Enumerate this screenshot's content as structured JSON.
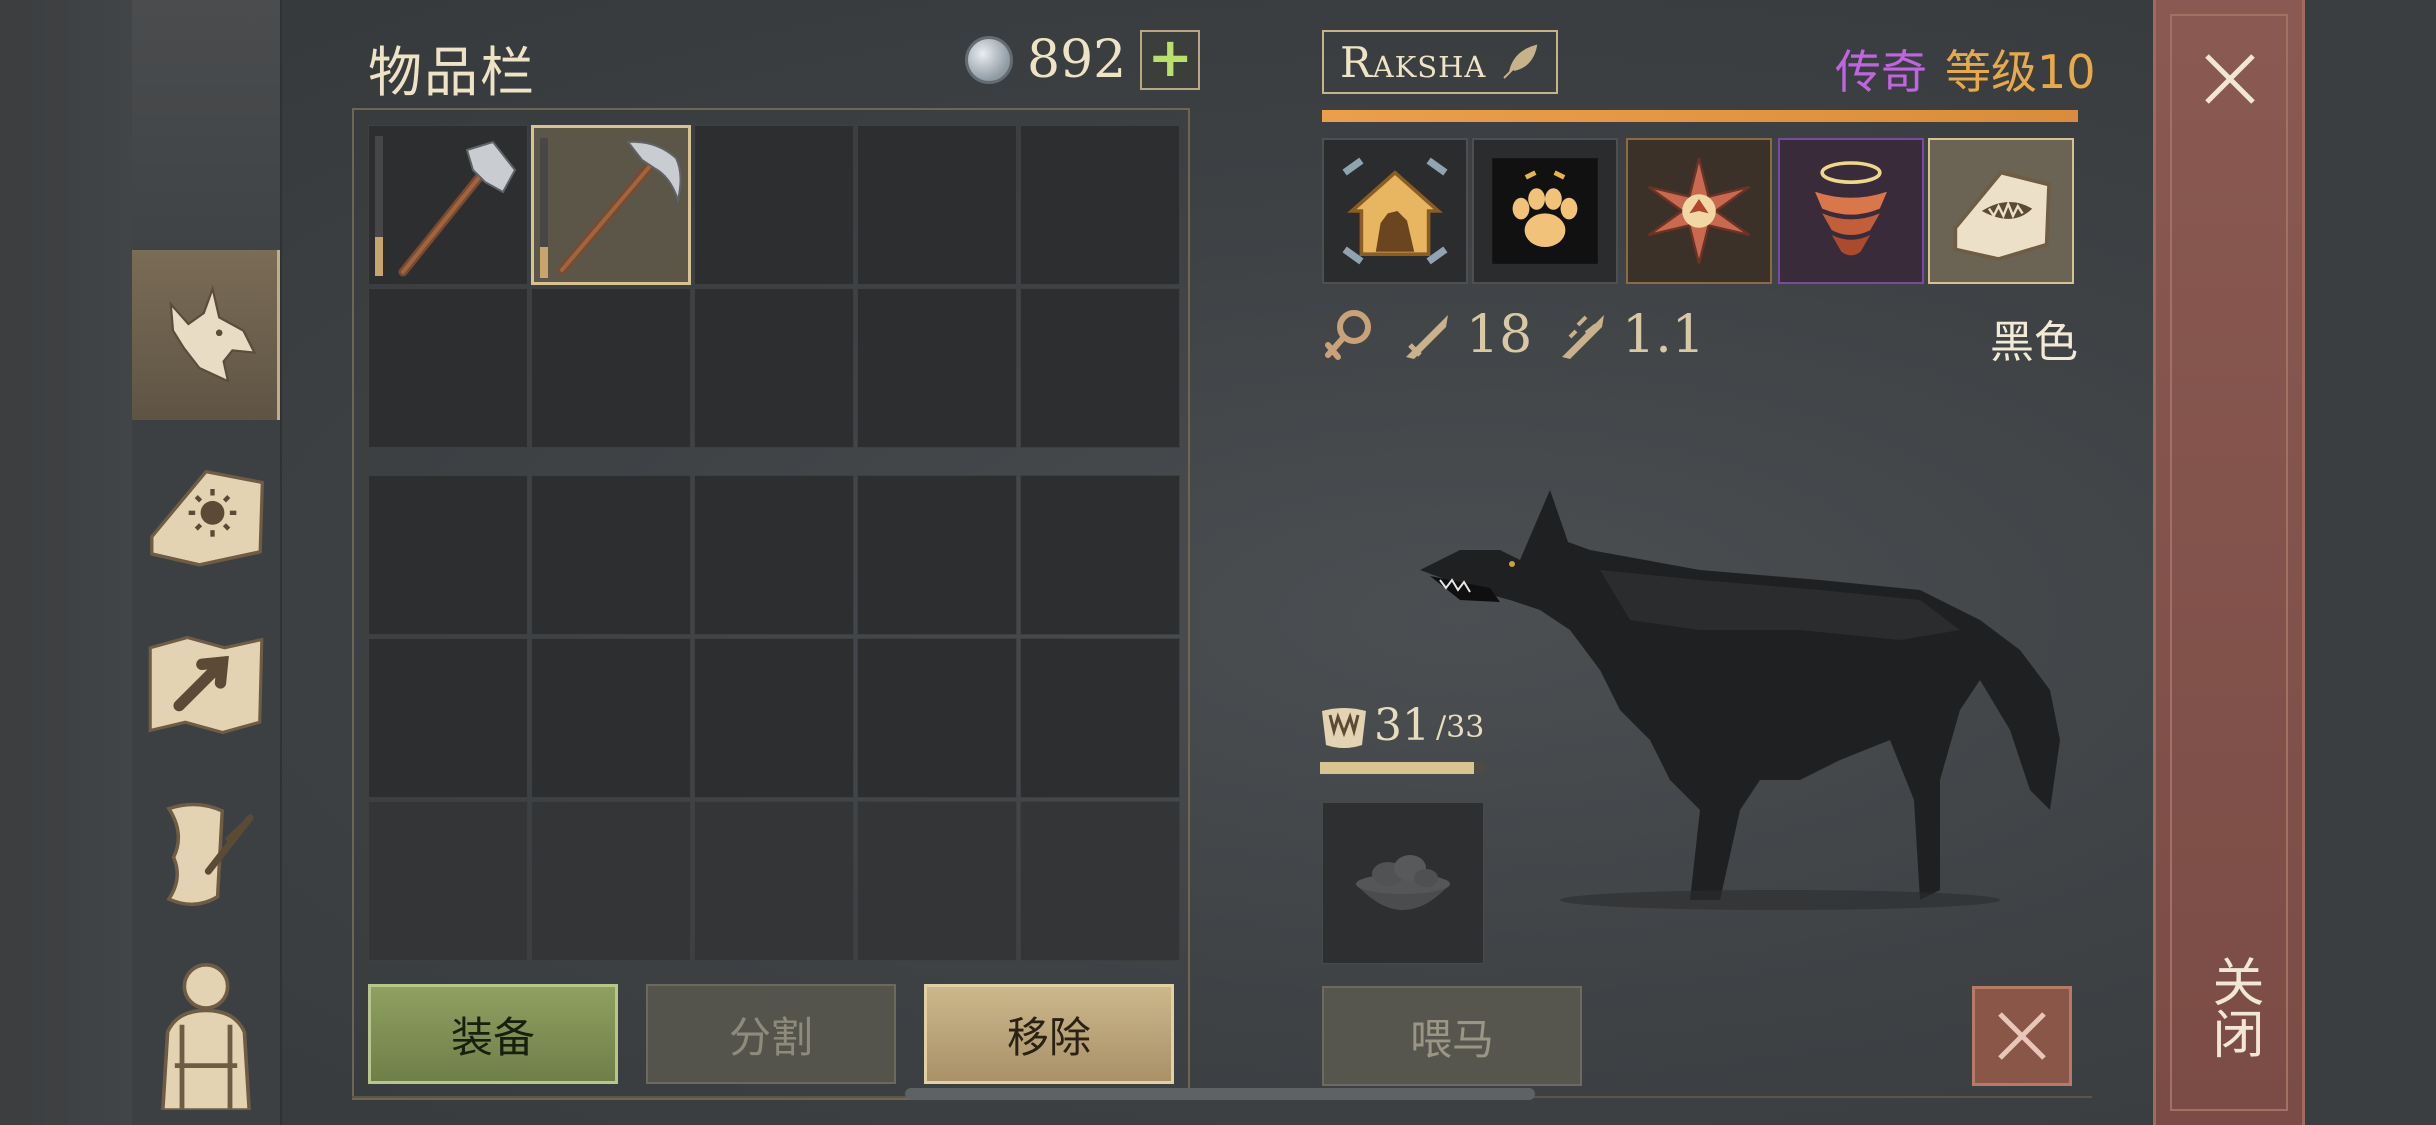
{
  "inventory": {
    "title": "物品栏",
    "currency_amount": "892",
    "currency_icon": "silver-coin-icon",
    "slots_top": [
      {
        "item": "hammer",
        "durability": 0.7
      },
      {
        "item": "pickaxe",
        "durability": 0.75,
        "selected": true
      },
      {},
      {},
      {},
      {},
      {},
      {},
      {},
      {}
    ],
    "slots_bottom": 15
  },
  "actions": {
    "equip": "装备",
    "split": "分割",
    "remove": "移除"
  },
  "pet": {
    "name": "Raksha",
    "rarity": "传奇",
    "level": "等级10",
    "traits": [
      "den-icon",
      "paw-icon",
      "star-compass-icon",
      "tornado-icon",
      "fang-book-icon"
    ],
    "attack": "18",
    "attack_speed": "1.1",
    "coat_color": "黑色",
    "hunger_current": "31",
    "hunger_max": "/33",
    "hunger_ratio": 0.94,
    "feed": "喂马"
  },
  "close_label": "关闭",
  "colors": {
    "accent_orange": "#e9a04a",
    "rarity_purple": "#c065e0",
    "level_gold": "#e8a94a",
    "equip_green": "#8fa061"
  }
}
